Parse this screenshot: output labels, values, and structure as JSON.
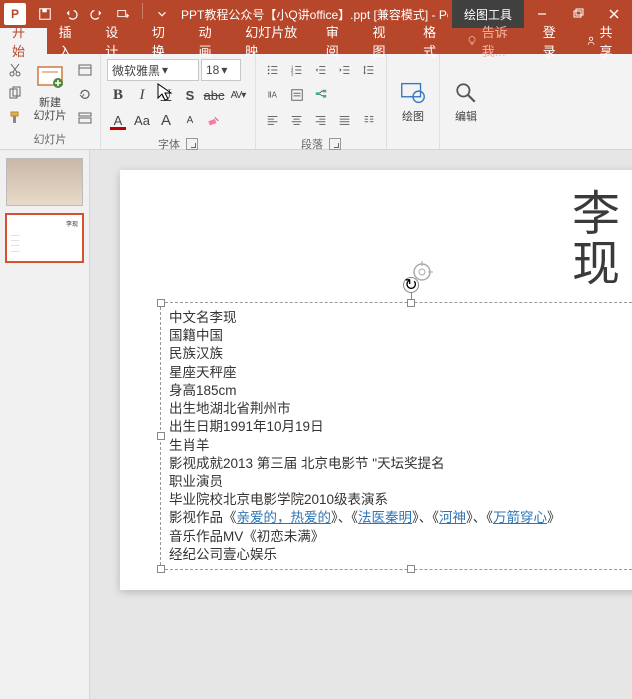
{
  "titlebar": {
    "title": "PPT教程公众号【小Q讲office】.ppt [兼容模式] - Pow...",
    "context": "绘图工具"
  },
  "tabs": {
    "home": "开始",
    "insert": "插入",
    "design": "设计",
    "transitions": "切换",
    "animations": "动画",
    "slideshow": "幻灯片放映",
    "review": "审阅",
    "view": "视图",
    "format": "格式",
    "tellme": "告诉我...",
    "signin": "登录",
    "share": "共享"
  },
  "ribbon": {
    "clipboard": {
      "newSlide": "新建\n幻灯片",
      "label": "幻灯片"
    },
    "font": {
      "name": "微软雅黑",
      "size": "18",
      "bold": "B",
      "italic": "I",
      "underline": "U",
      "shadow": "S",
      "strike": "abc",
      "spacing": "AV",
      "fontcolor": "A",
      "hilite": "Aa",
      "grow": "A",
      "shrink": "A",
      "label": "字体"
    },
    "para": {
      "label": "段落"
    },
    "drawing": {
      "label": "绘图"
    },
    "editing": {
      "label": "编辑"
    }
  },
  "slide": {
    "title": "李\n现",
    "lines": [
      "中文名李现",
      "国籍中国",
      "民族汉族",
      "星座天秤座",
      "身高185cm",
      "出生地湖北省荆州市",
      "出生日期1991年10月19日",
      "生肖羊",
      "影视成就2013 第三届 北京电影节 \"天坛奖提名",
      "职业演员",
      "毕业院校北京电影学院2010级表演系"
    ],
    "worksLine": {
      "prefix": "影视作品《",
      "l1": "亲爱的，热爱的",
      "s1": "》、《",
      "l2": "法医秦明",
      "s2": "》、《",
      "l3": "河神",
      "s3": "》、《",
      "l4": "万箭穿心",
      "suffix": "》"
    },
    "music": "音乐作品MV《初恋未满》",
    "agency": "经纪公司壹心娱乐"
  }
}
